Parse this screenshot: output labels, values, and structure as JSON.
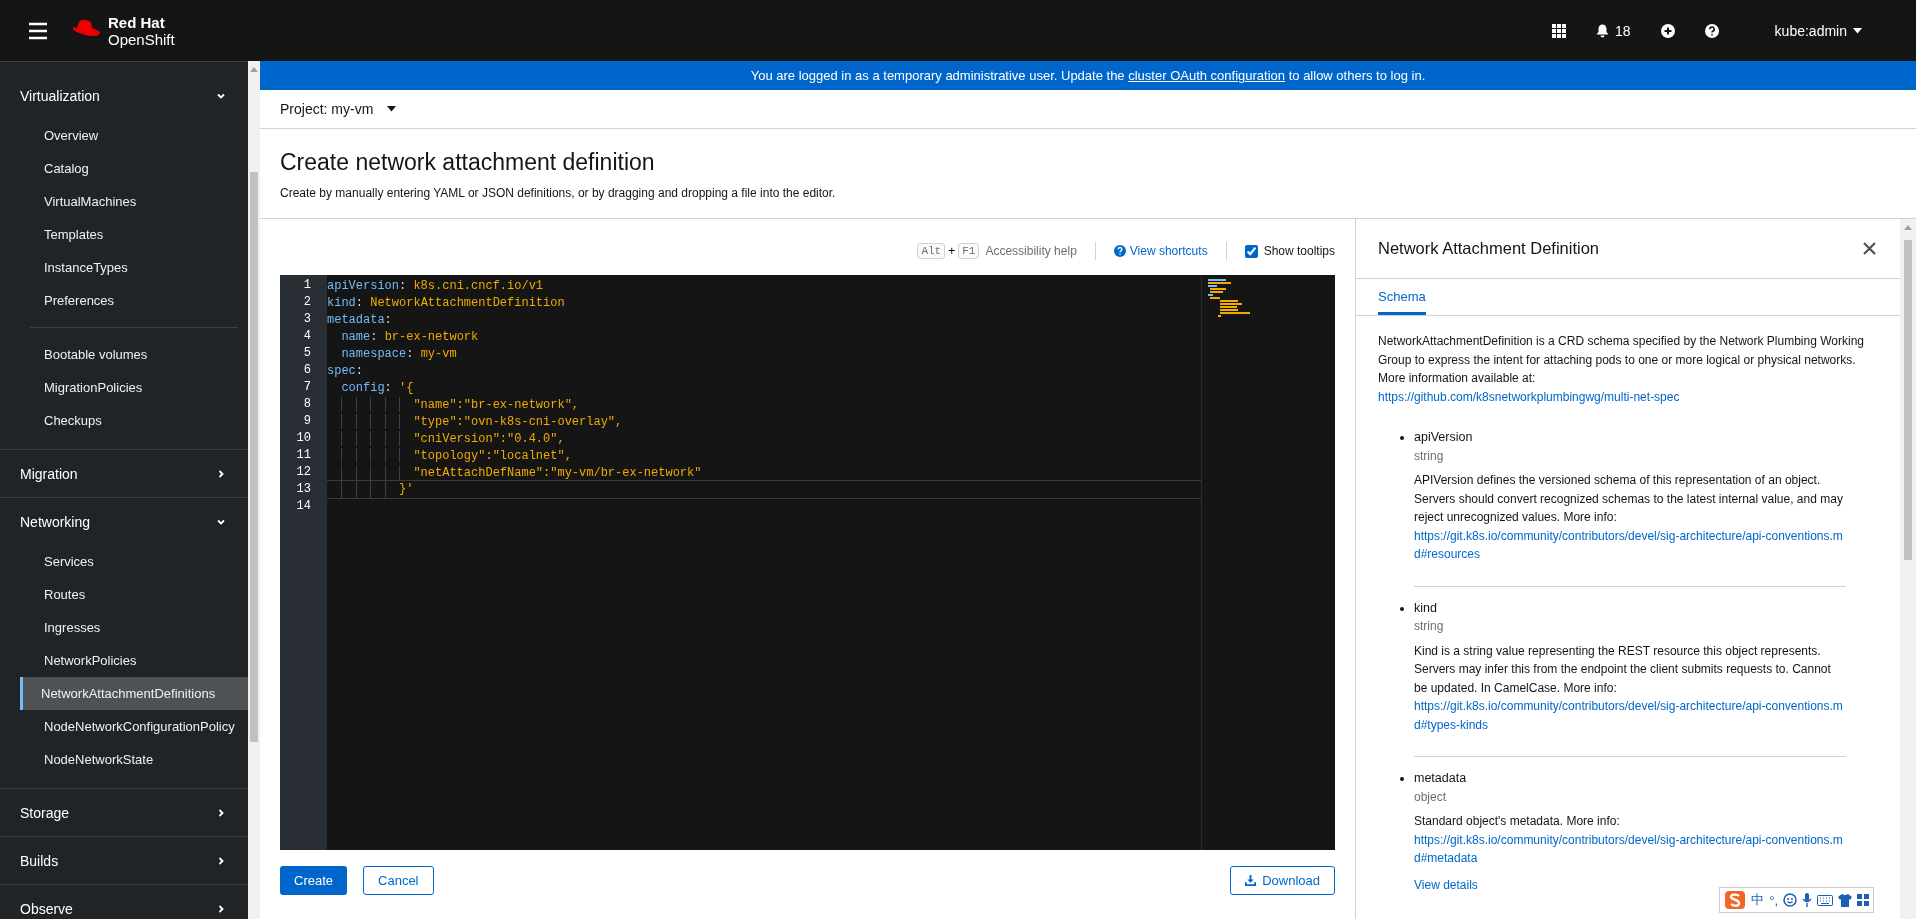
{
  "masthead": {
    "brand_top": "Red Hat",
    "brand_bottom": "OpenShift",
    "notifications": "18",
    "user": "kube:admin"
  },
  "sidebar": {
    "sections": [
      {
        "label": "Virtualization",
        "expanded": true,
        "groups": [
          [
            {
              "label": "Overview",
              "selected": false
            },
            {
              "label": "Catalog",
              "selected": false
            },
            {
              "label": "VirtualMachines",
              "selected": false
            },
            {
              "label": "Templates",
              "selected": false
            },
            {
              "label": "InstanceTypes",
              "selected": false
            },
            {
              "label": "Preferences",
              "selected": false
            }
          ],
          [
            {
              "label": "Bootable volumes",
              "selected": false
            },
            {
              "label": "MigrationPolicies",
              "selected": false
            },
            {
              "label": "Checkups",
              "selected": false
            }
          ]
        ]
      },
      {
        "label": "Migration",
        "expanded": false
      },
      {
        "label": "Networking",
        "expanded": true,
        "groups": [
          [
            {
              "label": "Services",
              "selected": false
            },
            {
              "label": "Routes",
              "selected": false
            },
            {
              "label": "Ingresses",
              "selected": false
            },
            {
              "label": "NetworkPolicies",
              "selected": false
            },
            {
              "label": "NetworkAttachmentDefinitions",
              "selected": true
            },
            {
              "label": "NodeNetworkConfigurationPolicy",
              "selected": false
            },
            {
              "label": "NodeNetworkState",
              "selected": false
            }
          ]
        ]
      },
      {
        "label": "Storage",
        "expanded": false
      },
      {
        "label": "Builds",
        "expanded": false
      },
      {
        "label": "Observe",
        "expanded": false
      }
    ]
  },
  "banner": {
    "before": "You are logged in as a temporary administrative user. Update the",
    "link": "cluster OAuth configuration",
    "after": "to allow others to log in."
  },
  "project": "Project: my-vm",
  "page": {
    "title": "Create network attachment definition",
    "description": "Create by manually entering YAML or JSON definitions, or by dragging and dropping a file into the editor."
  },
  "editor_toolbar": {
    "keys": [
      "Alt",
      "+",
      "F1"
    ],
    "accessibility": "Accessibility help",
    "shortcuts": "View shortcuts",
    "tooltips": {
      "label": "Show tooltips",
      "checked": true
    }
  },
  "editor": {
    "lines": [
      {
        "number": "1",
        "current": false,
        "tokens": [
          {
            "kind": "key",
            "text": "apiVersion"
          },
          {
            "kind": "punct",
            "text": ": "
          },
          {
            "kind": "value",
            "text": "k8s.cni.cncf.io/v1"
          }
        ]
      },
      {
        "number": "2",
        "current": false,
        "tokens": [
          {
            "kind": "key",
            "text": "kind"
          },
          {
            "kind": "punct",
            "text": ": "
          },
          {
            "kind": "value",
            "text": "NetworkAttachmentDefinition"
          }
        ]
      },
      {
        "number": "3",
        "current": false,
        "tokens": [
          {
            "kind": "key",
            "text": "metadata"
          },
          {
            "kind": "punct",
            "text": ":"
          }
        ]
      },
      {
        "number": "4",
        "current": false,
        "tokens": [
          {
            "kind": "key",
            "text": "  name"
          },
          {
            "kind": "punct",
            "text": ": "
          },
          {
            "kind": "value",
            "text": "br-ex-network"
          }
        ]
      },
      {
        "number": "5",
        "current": false,
        "tokens": [
          {
            "kind": "key",
            "text": "  namespace"
          },
          {
            "kind": "punct",
            "text": ": "
          },
          {
            "kind": "value",
            "text": "my-vm"
          }
        ]
      },
      {
        "number": "6",
        "current": false,
        "tokens": [
          {
            "kind": "key",
            "text": "spec"
          },
          {
            "kind": "punct",
            "text": ":"
          }
        ]
      },
      {
        "number": "7",
        "current": false,
        "tokens": [
          {
            "kind": "key",
            "text": "  config"
          },
          {
            "kind": "punct",
            "text": ": "
          },
          {
            "kind": "value",
            "text": "'{"
          }
        ]
      },
      {
        "number": "8",
        "current": false,
        "tokens": [
          {
            "kind": "value",
            "text": "            \"name\":\"br-ex-network\","
          }
        ]
      },
      {
        "number": "9",
        "current": false,
        "tokens": [
          {
            "kind": "value",
            "text": "            \"type\":\"ovn-k8s-cni-overlay\","
          }
        ]
      },
      {
        "number": "10",
        "current": false,
        "tokens": [
          {
            "kind": "value",
            "text": "            \"cniVersion\":\"0.4.0\","
          }
        ]
      },
      {
        "number": "11",
        "current": false,
        "tokens": [
          {
            "kind": "value",
            "text": "            \"topology\":\"localnet\","
          }
        ]
      },
      {
        "number": "12",
        "current": false,
        "tokens": [
          {
            "kind": "value",
            "text": "            \"netAttachDefName\":\"my-vm/br-ex-network\""
          }
        ]
      },
      {
        "number": "13",
        "current": true,
        "tokens": [
          {
            "kind": "value",
            "text": "          }'"
          }
        ]
      },
      {
        "number": "14",
        "current": false
      }
    ]
  },
  "actions": {
    "create": "Create",
    "cancel": "Cancel",
    "download": "Download"
  },
  "schema_panel": {
    "title": "Network Attachment Definition",
    "tabs": [
      {
        "label": "Schema",
        "selected": true
      }
    ],
    "intro": "NetworkAttachmentDefinition is a CRD schema specified by the Network Plumbing Working Group to express the intent for attaching pods to one or more logical or physical networks. More information available at:",
    "intro_link": "https://github.com/k8snetworkplumbingwg/multi-net-spec",
    "fields": [
      {
        "name": "apiVersion",
        "type": "string",
        "description": "APIVersion defines the versioned schema of this representation of an object. Servers should convert recognized schemas to the latest internal value, and may reject unrecognized values. More info:",
        "link": "https://git.k8s.io/community/contributors/devel/sig-architecture/api-conventions.md#resources"
      },
      {
        "name": "kind",
        "type": "string",
        "description": "Kind is a string value representing the REST resource this object represents. Servers may infer this from the endpoint the client submits requests to. Cannot be updated. In CamelCase. More info:",
        "link": "https://git.k8s.io/community/contributors/devel/sig-architecture/api-conventions.md#types-kinds"
      },
      {
        "name": "metadata",
        "type": "object",
        "description": "Standard object's metadata. More info:",
        "link": "https://git.k8s.io/community/contributors/devel/sig-architecture/api-conventions.md#metadata",
        "details": "View details"
      }
    ]
  },
  "ime_toolbar": {
    "mode": "中",
    "punctuation": "°,"
  }
}
